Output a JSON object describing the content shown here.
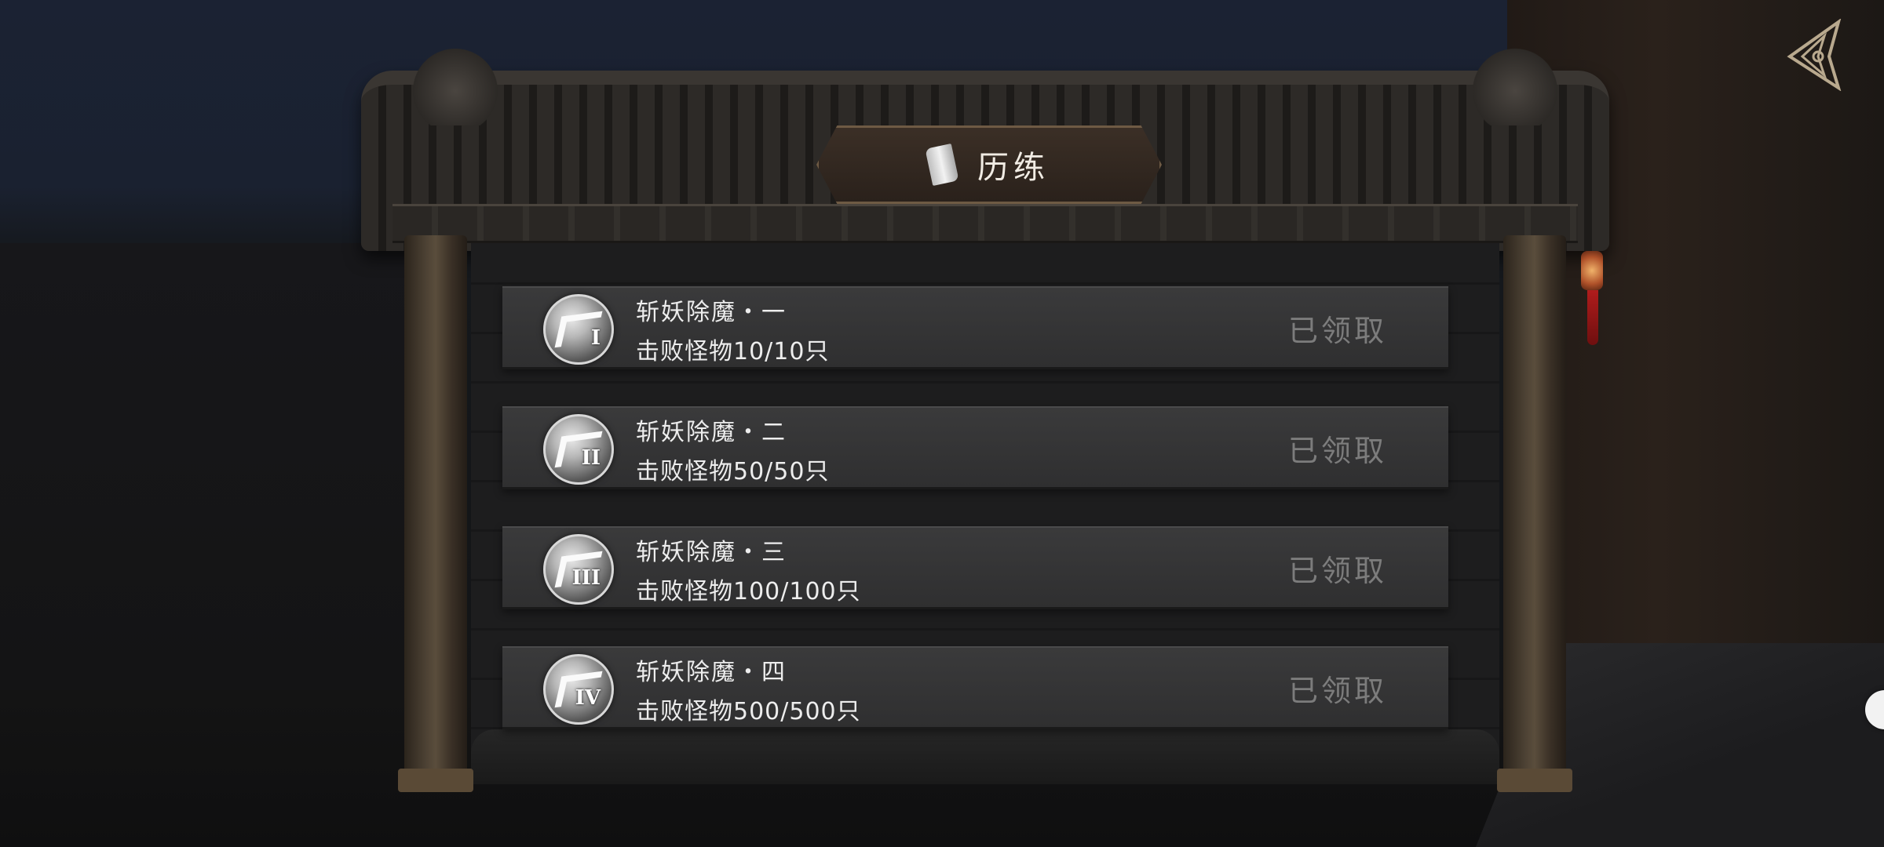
{
  "title": "历练",
  "tasks": [
    {
      "name": "斩妖除魔・一",
      "progress": "击败怪物10/10只",
      "numeral": "I",
      "status": "已领取"
    },
    {
      "name": "斩妖除魔・二",
      "progress": "击败怪物50/50只",
      "numeral": "II",
      "status": "已领取"
    },
    {
      "name": "斩妖除魔・三",
      "progress": "击败怪物100/100只",
      "numeral": "III",
      "status": "已领取"
    },
    {
      "name": "斩妖除魔・四",
      "progress": "击败怪物500/500只",
      "numeral": "IV",
      "status": "已领取"
    }
  ],
  "icons": {
    "title": "scroll-icon",
    "back": "back-arrow-icon",
    "badge": "rank-badge-icon"
  },
  "colors": {
    "title_text": "#f1ece4",
    "task_text": "#ededed",
    "claimed_text": "#7c7c7c",
    "row_bg": "#353536"
  }
}
